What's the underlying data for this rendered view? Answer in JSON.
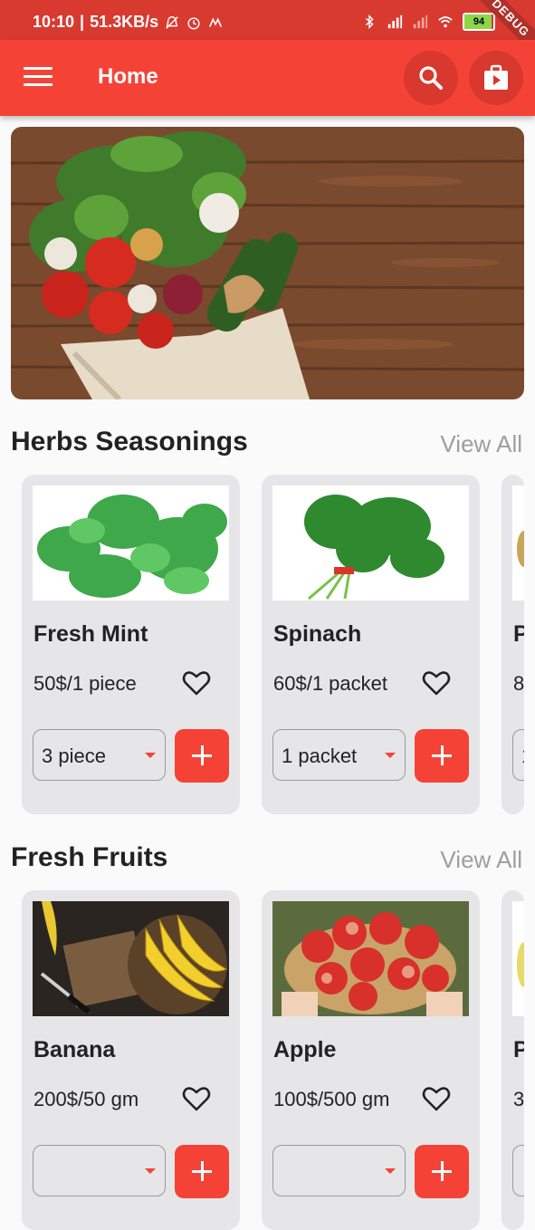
{
  "status_bar": {
    "time": "10:10",
    "speed": "51.3KB/s",
    "battery": "94",
    "debug_label": "DEBUG"
  },
  "app_bar": {
    "title": "Home"
  },
  "sections": [
    {
      "title": "Herbs Seasonings",
      "view_all": "View All",
      "products": [
        {
          "name": "Fresh Mint",
          "price": "50$/1 piece",
          "quantity": "3 piece"
        },
        {
          "name": "Spinach",
          "price": "60$/1 packet",
          "quantity": "1 packet"
        },
        {
          "name": "P",
          "price": "8",
          "quantity": "1"
        }
      ]
    },
    {
      "title": "Fresh Fruits",
      "view_all": "View All",
      "products": [
        {
          "name": "Banana",
          "price": "200$/50 gm",
          "quantity": ""
        },
        {
          "name": "Apple",
          "price": "100$/500 gm",
          "quantity": ""
        },
        {
          "name": "P",
          "price": "3",
          "quantity": ""
        }
      ]
    }
  ],
  "colors": {
    "primary": "#f44336",
    "status_bar": "#d83a30",
    "card": "#e6e6e8"
  }
}
